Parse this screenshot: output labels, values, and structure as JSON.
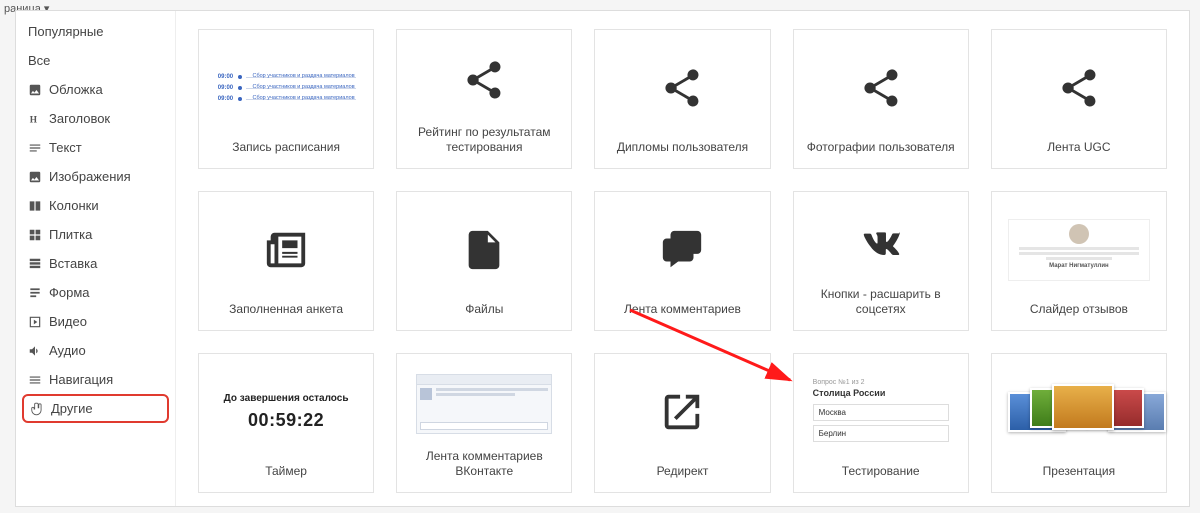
{
  "top": {
    "fragment": "раница ▾"
  },
  "sidebar": {
    "items": [
      {
        "label": "Популярные",
        "icon": null
      },
      {
        "label": "Все",
        "icon": null
      },
      {
        "label": "Обложка",
        "icon": "image"
      },
      {
        "label": "Заголовок",
        "icon": "heading"
      },
      {
        "label": "Текст",
        "icon": "text"
      },
      {
        "label": "Изображения",
        "icon": "image"
      },
      {
        "label": "Колонки",
        "icon": "columns"
      },
      {
        "label": "Плитка",
        "icon": "grid"
      },
      {
        "label": "Вставка",
        "icon": "embed"
      },
      {
        "label": "Форма",
        "icon": "form"
      },
      {
        "label": "Видео",
        "icon": "video"
      },
      {
        "label": "Аудио",
        "icon": "audio"
      },
      {
        "label": "Навигация",
        "icon": "nav"
      },
      {
        "label": "Другие",
        "icon": "hand"
      }
    ],
    "highlighted_index": 13
  },
  "tiles": [
    {
      "label": "Запись расписания",
      "preview": "schedule"
    },
    {
      "label": "Рейтинг по результатам тестирования",
      "preview": "share"
    },
    {
      "label": "Дипломы пользователя",
      "preview": "share"
    },
    {
      "label": "Фотографии пользователя",
      "preview": "share"
    },
    {
      "label": "Лента UGC",
      "preview": "share"
    },
    {
      "label": "Заполненная анкета",
      "preview": "newspaper"
    },
    {
      "label": "Файлы",
      "preview": "file"
    },
    {
      "label": "Лента комментариев",
      "preview": "comments"
    },
    {
      "label": "Кнопки - расшарить в соцсетях",
      "preview": "vk"
    },
    {
      "label": "Слайдер отзывов",
      "preview": "reviews"
    },
    {
      "label": "Таймер",
      "preview": "timer"
    },
    {
      "label": "Лента комментариев ВКонтакте",
      "preview": "vkcomments"
    },
    {
      "label": "Редирект",
      "preview": "redirect"
    },
    {
      "label": "Тестирование",
      "preview": "quiz"
    },
    {
      "label": "Презентация",
      "preview": "presentation"
    }
  ],
  "schedule_preview": {
    "time": "09:00",
    "text": "Сбор участников и раздача материалов"
  },
  "timer_preview": {
    "caption": "До завершения осталось",
    "value": "00:59:22"
  },
  "quiz_preview": {
    "counter": "Вопрос №1 из 2",
    "title": "Столица России",
    "options": [
      "Москва",
      "Берлин"
    ]
  },
  "reviews_preview": {
    "name": "Марат Нигматуллин"
  }
}
